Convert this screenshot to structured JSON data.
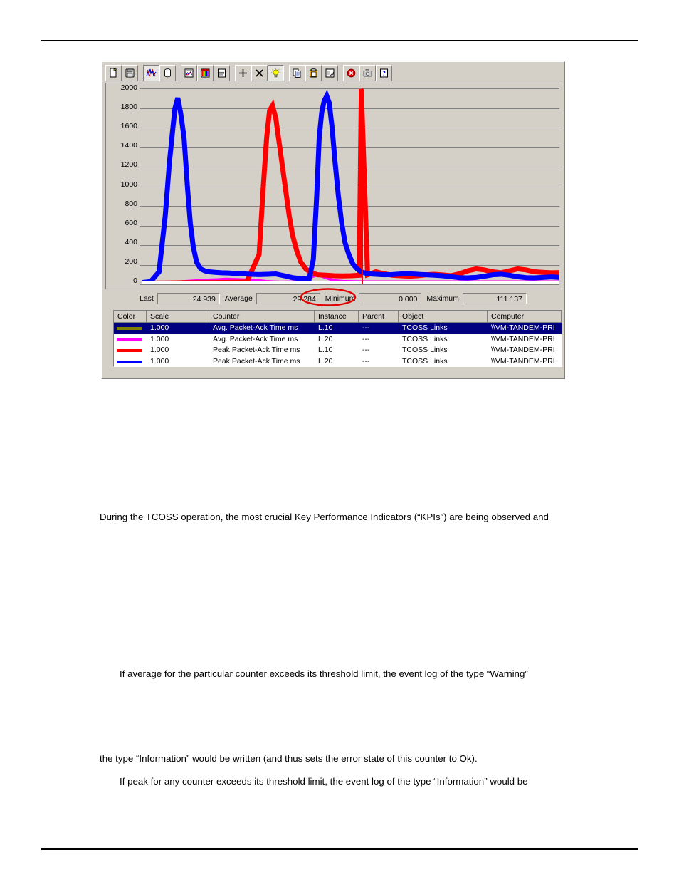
{
  "document": {
    "paragraphs": [
      "During the TCOSS operation, the most crucial Key Performance Indicators (“KPIs”) are being observed and",
      "If average for the particular counter exceeds its threshold limit, the event log of the type “Warning”",
      "the type “Information” would be written (and thus sets the error state of this counter to Ok).",
      "If peak for any counter exceeds its threshold limit, the event log of the type “Information” would be"
    ]
  },
  "perfmon": {
    "toolbar": {
      "buttons": [
        {
          "name": "new-chart-icon",
          "state": "raised"
        },
        {
          "name": "open-file-icon",
          "state": "raised"
        },
        {
          "name": "chart-view-icon",
          "state": "pressed"
        },
        {
          "name": "alert-view-icon",
          "state": "raised"
        },
        {
          "name": "log-view-icon",
          "state": "raised"
        },
        {
          "name": "report-view-icon",
          "state": "raised"
        },
        {
          "name": "counter-list-icon",
          "state": "raised"
        },
        {
          "name": "add-counter-icon",
          "state": "raised"
        },
        {
          "name": "delete-counter-icon",
          "state": "raised"
        },
        {
          "name": "highlight-icon",
          "state": "pressed"
        },
        {
          "name": "copy-icon",
          "state": "raised"
        },
        {
          "name": "paste-icon",
          "state": "raised"
        },
        {
          "name": "options-icon",
          "state": "raised"
        },
        {
          "name": "stop-icon",
          "state": "raised"
        },
        {
          "name": "snapshot-icon",
          "state": "raised"
        },
        {
          "name": "help-icon",
          "state": "raised"
        }
      ]
    },
    "value_bar": {
      "last_label": "Last",
      "last_value": "24.939",
      "average_label": "Average",
      "average_value": "29.284",
      "minimum_label": "Minimum",
      "minimum_value": "0.000",
      "maximum_label": "Maximum",
      "maximum_value": "111.137",
      "annotation_color": "#e00000"
    },
    "legend": {
      "headers": [
        "Color",
        "Scale",
        "Counter",
        "Instance",
        "Parent",
        "Object",
        "Computer"
      ],
      "rows": [
        {
          "color": "#808000",
          "scale": "1.000",
          "counter": "Avg. Packet-Ack Time ms",
          "instance": "L.10",
          "parent": "---",
          "object": "TCOSS Links",
          "computer": "\\\\VM-TANDEM-PRI",
          "selected": true
        },
        {
          "color": "#ff00ff",
          "scale": "1.000",
          "counter": "Avg. Packet-Ack Time ms",
          "instance": "L.20",
          "parent": "---",
          "object": "TCOSS Links",
          "computer": "\\\\VM-TANDEM-PRI",
          "selected": false
        },
        {
          "color": "#ff0000",
          "scale": "1.000",
          "counter": "Peak Packet-Ack Time ms",
          "instance": "L.10",
          "parent": "---",
          "object": "TCOSS Links",
          "computer": "\\\\VM-TANDEM-PRI",
          "selected": false
        },
        {
          "color": "#0000ff",
          "scale": "1.000",
          "counter": "Peak Packet-Ack Time ms",
          "instance": "L.20",
          "parent": "---",
          "object": "TCOSS Links",
          "computer": "\\\\VM-TANDEM-PRI",
          "selected": false
        }
      ]
    }
  },
  "chart_data": {
    "type": "line",
    "title": "",
    "xlabel": "",
    "ylabel": "",
    "ylim": [
      0,
      2000
    ],
    "ytick_labels": [
      "2000",
      "1800",
      "1600",
      "1400",
      "1200",
      "1000",
      "800",
      "600",
      "400",
      "200",
      "0"
    ],
    "ytick_values": [
      2000,
      1800,
      1600,
      1400,
      1200,
      1000,
      800,
      600,
      400,
      200,
      0
    ],
    "grid": true,
    "legend_position": "bottom-table",
    "cursor_x_fraction": 0.525,
    "cursor_color": "#ff0000",
    "series": [
      {
        "name": "Peak Packet-Ack Time ms (L.20)",
        "color": "#0000ff",
        "x": [
          0.0,
          0.02,
          0.04,
          0.055,
          0.065,
          0.072,
          0.078,
          0.085,
          0.092,
          0.1,
          0.108,
          0.115,
          0.122,
          0.13,
          0.14,
          0.15,
          0.16,
          0.175,
          0.19,
          0.205,
          0.22,
          0.24,
          0.26,
          0.28,
          0.3,
          0.32,
          0.34,
          0.36,
          0.38,
          0.4,
          0.41,
          0.418,
          0.424,
          0.43,
          0.436,
          0.442,
          0.448,
          0.455,
          0.462,
          0.47,
          0.478,
          0.486,
          0.495,
          0.505,
          0.515,
          0.525,
          0.54,
          0.56,
          0.58,
          0.6,
          0.62,
          0.64,
          0.66,
          0.68,
          0.7,
          0.72,
          0.74,
          0.76,
          0.78,
          0.8,
          0.82,
          0.84,
          0.86,
          0.88,
          0.9,
          0.92,
          0.94,
          0.96,
          0.98,
          1.0
        ],
        "y": [
          10,
          20,
          120,
          700,
          1250,
          1550,
          1800,
          1910,
          1750,
          1500,
          1000,
          620,
          380,
          220,
          150,
          130,
          120,
          115,
          110,
          108,
          105,
          100,
          95,
          92,
          95,
          98,
          80,
          60,
          50,
          45,
          250,
          900,
          1500,
          1760,
          1880,
          1930,
          1860,
          1600,
          1250,
          900,
          620,
          420,
          300,
          200,
          150,
          120,
          100,
          95,
          90,
          92,
          98,
          100,
          95,
          90,
          85,
          80,
          70,
          60,
          58,
          62,
          75,
          90,
          95,
          85,
          70,
          60,
          58,
          62,
          68,
          62
        ]
      },
      {
        "name": "Peak Packet-Ack Time ms (L.10)",
        "color": "#ff0000",
        "x": [
          0.0,
          0.05,
          0.1,
          0.15,
          0.2,
          0.25,
          0.28,
          0.29,
          0.298,
          0.305,
          0.312,
          0.32,
          0.328,
          0.336,
          0.344,
          0.352,
          0.36,
          0.37,
          0.38,
          0.392,
          0.405,
          0.42,
          0.44,
          0.46,
          0.48,
          0.5,
          0.52,
          0.525,
          0.54,
          0.56,
          0.58,
          0.6,
          0.62,
          0.64,
          0.66,
          0.68,
          0.7,
          0.72,
          0.74,
          0.76,
          0.78,
          0.8,
          0.82,
          0.84,
          0.86,
          0.88,
          0.9,
          0.92,
          0.94,
          0.96,
          0.98,
          1.0
        ],
        "y": [
          5,
          5,
          8,
          8,
          10,
          15,
          300,
          1000,
          1500,
          1780,
          1830,
          1700,
          1450,
          1200,
          950,
          700,
          500,
          340,
          220,
          150,
          110,
          90,
          85,
          80,
          78,
          80,
          85,
          2000,
          90,
          120,
          100,
          85,
          80,
          75,
          80,
          90,
          95,
          88,
          80,
          100,
          130,
          150,
          140,
          120,
          110,
          130,
          150,
          140,
          120,
          115,
          110,
          112
        ]
      },
      {
        "name": "Avg. Packet-Ack Time ms (L.20)",
        "color": "#ff00ff",
        "x": [
          0.0,
          0.05,
          0.1,
          0.15,
          0.18,
          0.2,
          0.22,
          0.25,
          0.28,
          0.3,
          0.33,
          0.36,
          0.38,
          0.4,
          0.42,
          0.44,
          0.46,
          0.48,
          0.5,
          0.55,
          0.6,
          0.7,
          0.8,
          0.9,
          1.0
        ],
        "y": [
          5,
          10,
          20,
          35,
          40,
          45,
          42,
          38,
          30,
          20,
          15,
          18,
          30,
          60,
          90,
          60,
          30,
          22,
          20,
          18,
          18,
          18,
          18,
          18,
          18
        ]
      },
      {
        "name": "Avg. Packet-Ack Time ms (L.10)",
        "color": "#808000",
        "x": [
          0.0,
          0.25,
          0.5,
          0.75,
          1.0
        ],
        "y": [
          3,
          3,
          3,
          3,
          3
        ]
      }
    ]
  }
}
